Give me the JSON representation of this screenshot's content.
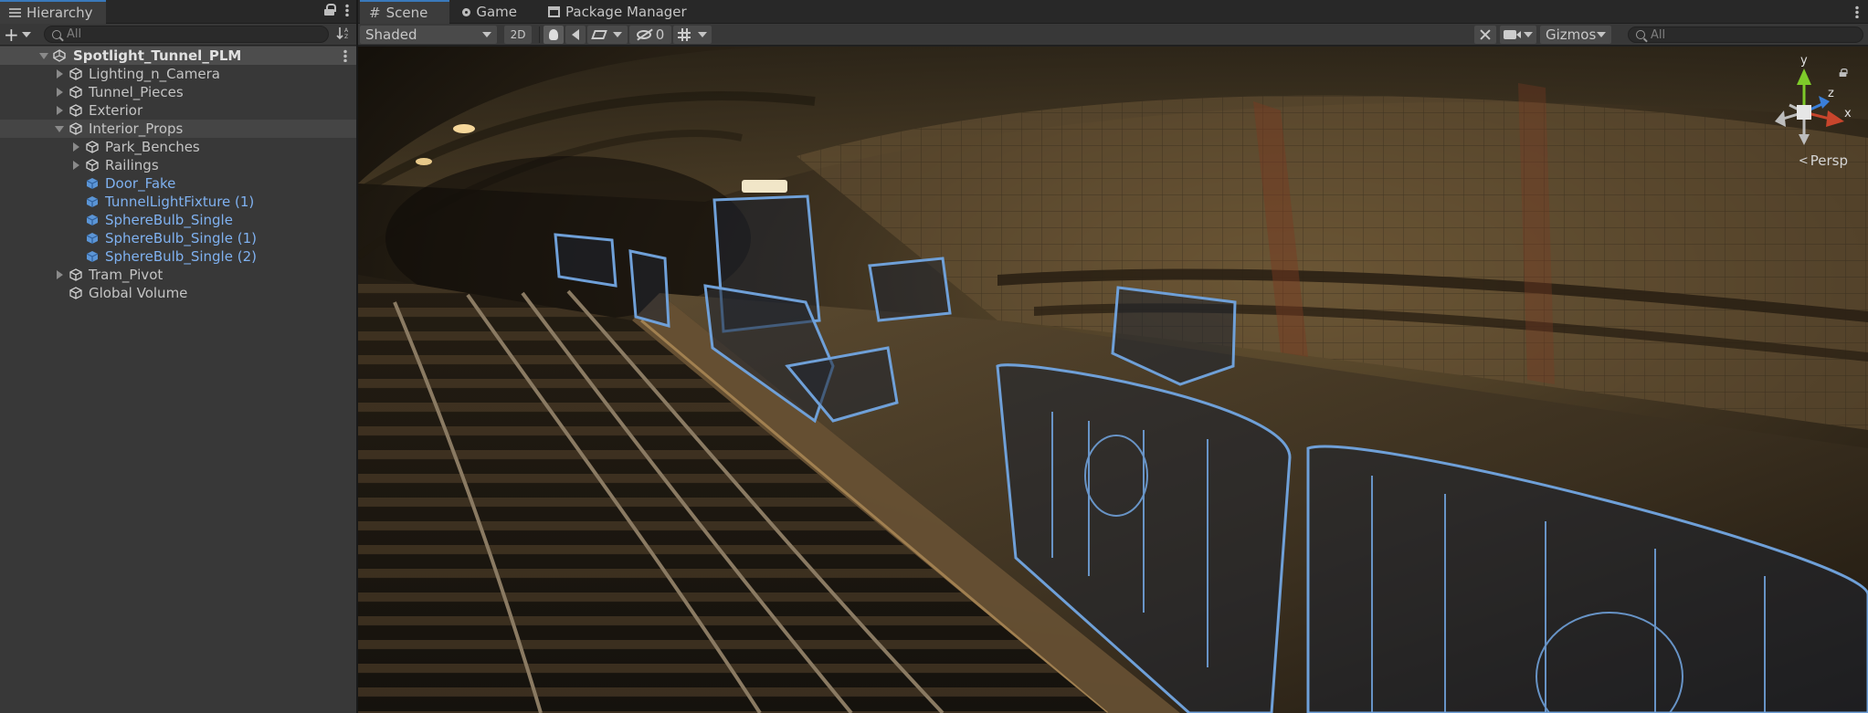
{
  "hierarchy": {
    "title": "Hierarchy",
    "search_placeholder": "All",
    "items": [
      {
        "label": "Spotlight_Tunnel_PLM"
      },
      {
        "label": "Lighting_n_Camera"
      },
      {
        "label": "Tunnel_Pieces"
      },
      {
        "label": "Exterior"
      },
      {
        "label": "Interior_Props"
      },
      {
        "label": "Park_Benches"
      },
      {
        "label": "Railings"
      },
      {
        "label": "Door_Fake"
      },
      {
        "label": "TunnelLightFixture (1)"
      },
      {
        "label": "SphereBulb_Single"
      },
      {
        "label": "SphereBulb_Single (1)"
      },
      {
        "label": "SphereBulb_Single (2)"
      },
      {
        "label": "Tram_Pivot"
      },
      {
        "label": "Global Volume"
      }
    ]
  },
  "scene": {
    "tabs": [
      {
        "label": "Scene"
      },
      {
        "label": "Game"
      },
      {
        "label": "Package Manager"
      }
    ],
    "toolbar": {
      "draw_mode": "Shaded",
      "toggle_2d": "2D",
      "hidden_count": "0",
      "gizmos_label": "Gizmos",
      "search_placeholder": "All"
    },
    "gizmo": {
      "axis_y": "y",
      "axis_x": "x",
      "axis_z": "z",
      "projection": "Persp"
    }
  },
  "colors": {
    "selection_outline": "#6fa0d8",
    "active_tab_accent": "#3a79bb",
    "prefab_label": "#7fb1f0",
    "axis_x": "#c8452c",
    "axis_y": "#7ecb2a",
    "axis_z": "#3a7fd9"
  }
}
